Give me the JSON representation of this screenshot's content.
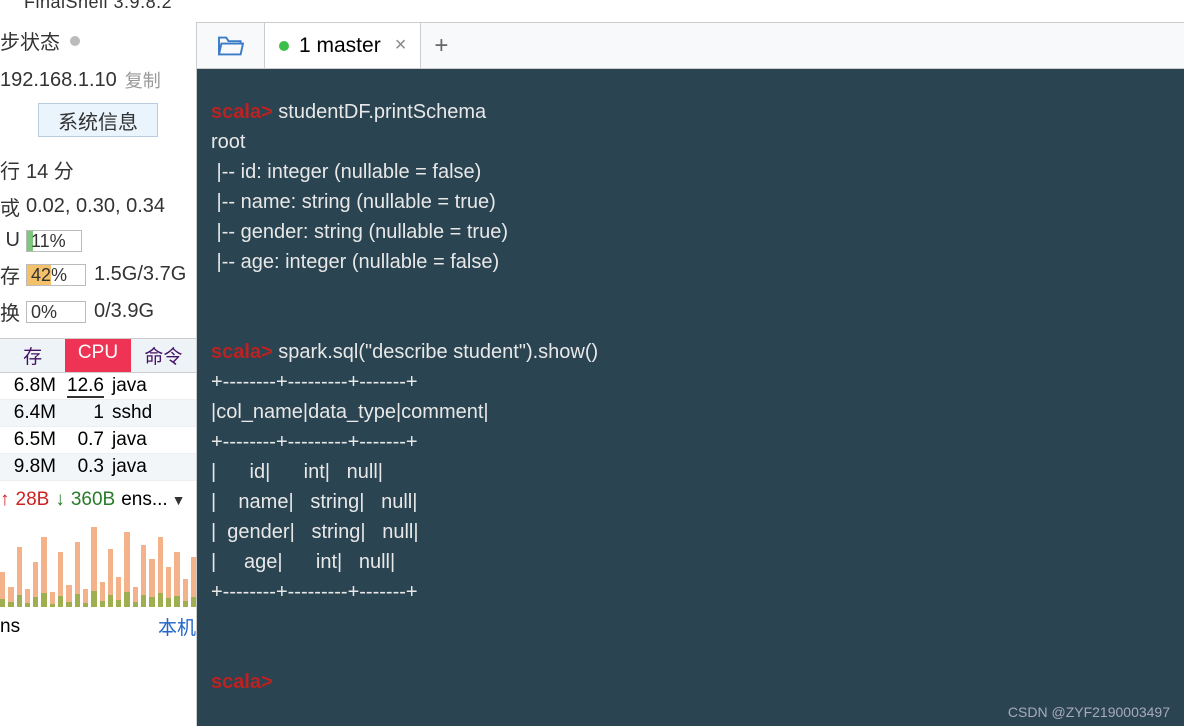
{
  "app_title": "FinalShell 3.9.8.2",
  "sidebar": {
    "sync_label": "步状态",
    "ip": "192.168.1.10",
    "copy": "复制",
    "sysinfo_btn": "系统信息",
    "rows": {
      "uptime_label": "行",
      "uptime_val": "14 分",
      "load_label": "戓",
      "load_val": "0.02, 0.30, 0.34",
      "cpu_label": "U",
      "cpu_pct": "11%",
      "mem_label": "存",
      "mem_pct": "42%",
      "mem_val": "1.5G/3.7G",
      "swap_label": "换",
      "swap_pct": "0%",
      "swap_val": "0/3.9G"
    },
    "proc_head": {
      "mem": "存",
      "cpu": "CPU",
      "cmd": "命令"
    },
    "procs": [
      {
        "mem": "6.8M",
        "cpu": "12.6",
        "cmd": "java"
      },
      {
        "mem": "6.4M",
        "cpu": "1",
        "cmd": "sshd"
      },
      {
        "mem": "6.5M",
        "cpu": "0.7",
        "cmd": "java"
      },
      {
        "mem": "9.8M",
        "cpu": "0.3",
        "cmd": "java"
      }
    ],
    "net": {
      "up": "28B",
      "dn": "360B",
      "iface": "ens..."
    },
    "ns": "ns",
    "local": "本机"
  },
  "tab": {
    "label": "1 master"
  },
  "terminal": {
    "prompt": "scala>",
    "cmd1": " studentDF.printSchema",
    "out1": [
      "root",
      " |-- id: integer (nullable = false)",
      " |-- name: string (nullable = true)",
      " |-- gender: string (nullable = true)",
      " |-- age: integer (nullable = false)"
    ],
    "cmd2": " spark.sql(\"describe student\").show()",
    "out2": [
      "+--------+---------+-------+",
      "|col_name|data_type|comment|",
      "+--------+---------+-------+",
      "|      id|      int|   null|",
      "|    name|   string|   null|",
      "|  gender|   string|   null|",
      "|     age|      int|   null|",
      "+--------+---------+-------+"
    ]
  },
  "watermark": "CSDN @ZYF2190003497",
  "chart_data": {
    "type": "bar",
    "title": "",
    "xlabel": "",
    "ylabel": "",
    "series": [
      {
        "name": "net-up",
        "values": [
          35,
          20,
          60,
          18,
          45,
          70,
          15,
          55,
          22,
          65,
          18,
          80,
          25,
          58,
          30,
          75,
          20,
          62,
          48,
          70,
          40,
          55,
          28,
          50
        ]
      },
      {
        "name": "net-dn",
        "values": [
          8,
          5,
          12,
          4,
          10,
          14,
          3,
          11,
          5,
          13,
          4,
          16,
          6,
          12,
          7,
          15,
          5,
          12,
          10,
          14,
          9,
          11,
          6,
          10
        ]
      }
    ]
  }
}
